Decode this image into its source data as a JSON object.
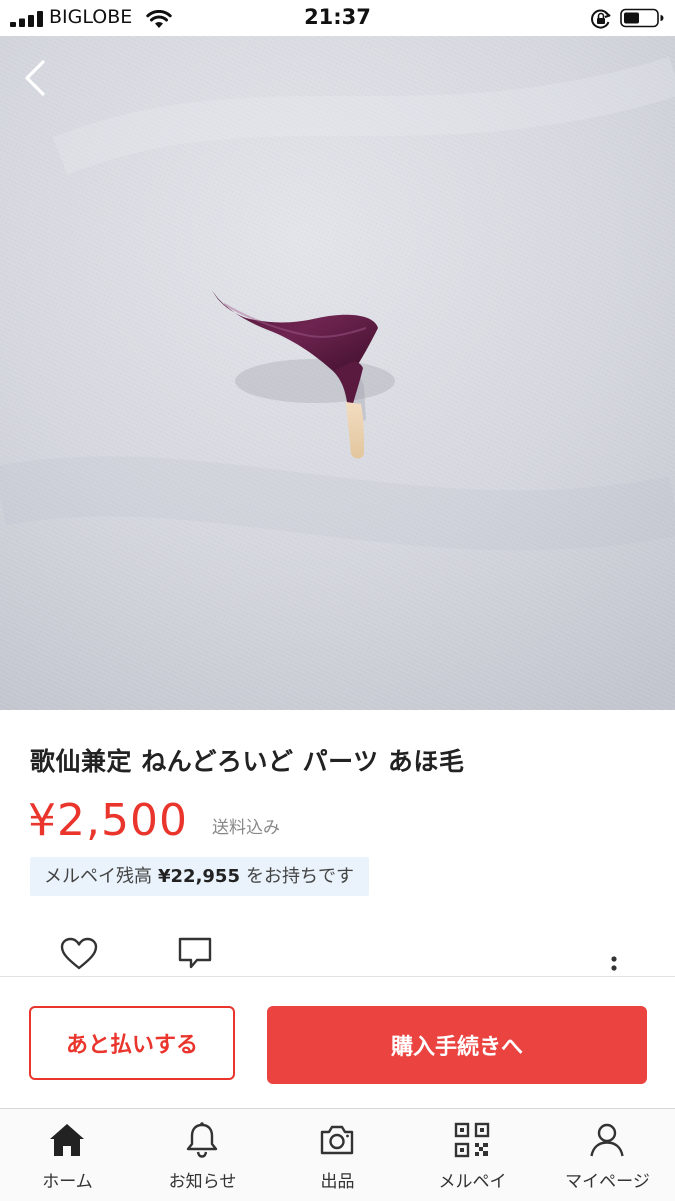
{
  "status_bar": {
    "carrier": "BIGLOBE",
    "time": "21:37",
    "icons": [
      "signal-icon",
      "wifi-icon",
      "orientation-lock-icon",
      "battery-icon"
    ]
  },
  "hero": {
    "back_icon": "chevron-left-icon",
    "image_subject": "purple hair part on gray fabric"
  },
  "item": {
    "title": "歌仙兼定 ねんどろいど パーツ あほ毛",
    "price": "¥2,500",
    "shipping": "送料込み"
  },
  "balance": {
    "prefix": "メルペイ残高",
    "amount": "¥22,955",
    "suffix": "をお持ちです"
  },
  "actions": {
    "icons": [
      "heart-icon",
      "comment-icon",
      "more-vertical-icon"
    ]
  },
  "purchase": {
    "later_label": "あと払いする",
    "buy_label": "購入手続きへ"
  },
  "tabs": [
    {
      "label": "ホーム",
      "icon": "home-icon"
    },
    {
      "label": "お知らせ",
      "icon": "bell-icon"
    },
    {
      "label": "出品",
      "icon": "camera-icon"
    },
    {
      "label": "メルペイ",
      "icon": "qr-code-icon"
    },
    {
      "label": "マイページ",
      "icon": "person-icon"
    }
  ],
  "colors": {
    "accent": "#ea352d",
    "buy_button": "#ea4340",
    "balance_bg": "#eaf3fb",
    "text": "#222222"
  }
}
